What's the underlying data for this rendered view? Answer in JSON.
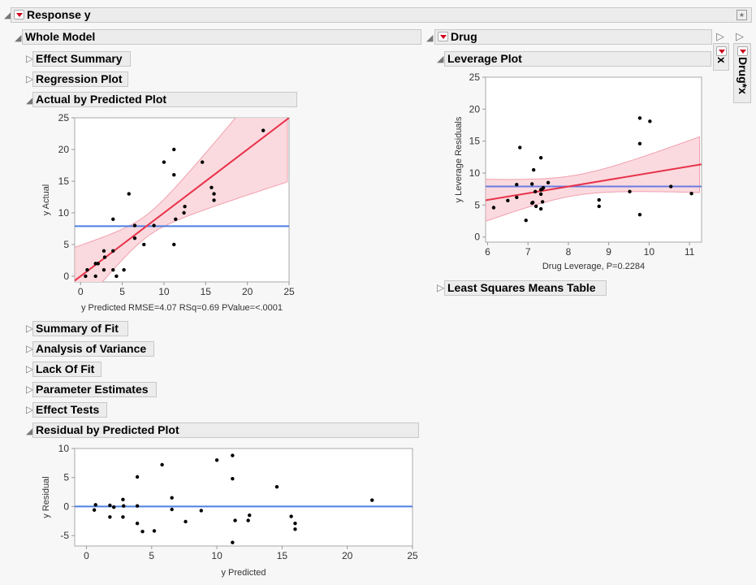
{
  "report": {
    "title": "Response y",
    "whole_model": "Whole Model",
    "sections_left": [
      {
        "label": "Effect Summary",
        "state": "collapsed"
      },
      {
        "label": "Regression Plot",
        "state": "collapsed"
      },
      {
        "label": "Actual by Predicted Plot",
        "state": "expanded"
      },
      {
        "label": "Summary of Fit",
        "state": "collapsed"
      },
      {
        "label": "Analysis of Variance",
        "state": "collapsed"
      },
      {
        "label": "Lack Of Fit",
        "state": "collapsed"
      },
      {
        "label": "Parameter Estimates",
        "state": "collapsed"
      },
      {
        "label": "Effect Tests",
        "state": "collapsed"
      },
      {
        "label": "Residual by Predicted Plot",
        "state": "expanded"
      }
    ],
    "drug": "Drug",
    "leverage_plot": "Leverage Plot",
    "ls_means": "Least Squares Means Table",
    "tab_x": "x",
    "tab_drugx": "Drug*x"
  },
  "colors": {
    "fit_line": "#e8334a",
    "ci_band": "#fadadf",
    "mean_line_blue": "#4d7fe0",
    "mean_line_lev": "#6b7be0"
  },
  "chart_data": [
    {
      "type": "scatter",
      "name": "actual-by-predicted",
      "xlabel": "y Predicted RMSE=4.07 RSq=0.69 PValue=<.0001",
      "ylabel": "y Actual",
      "xlim": [
        -0.7,
        25
      ],
      "ylim": [
        -0.9,
        25
      ],
      "xticks": [
        0,
        5,
        10,
        15,
        20,
        25
      ],
      "yticks": [
        0,
        5,
        10,
        15,
        20,
        25
      ],
      "mean_line": 7.9,
      "fit": {
        "slope": 1,
        "intercept": 0
      },
      "points": [
        [
          0.6,
          0
        ],
        [
          0.8,
          1
        ],
        [
          1.8,
          0
        ],
        [
          1.8,
          2
        ],
        [
          2.1,
          2
        ],
        [
          2.8,
          1
        ],
        [
          2.8,
          4
        ],
        [
          2.9,
          3
        ],
        [
          3.9,
          1
        ],
        [
          3.9,
          4
        ],
        [
          3.9,
          9
        ],
        [
          4.3,
          0
        ],
        [
          5.2,
          1
        ],
        [
          5.8,
          13
        ],
        [
          6.5,
          6
        ],
        [
          6.5,
          8
        ],
        [
          7.6,
          5
        ],
        [
          8.8,
          8
        ],
        [
          10.0,
          18
        ],
        [
          11.2,
          20
        ],
        [
          11.2,
          16
        ],
        [
          11.2,
          5
        ],
        [
          11.4,
          9
        ],
        [
          12.4,
          10
        ],
        [
          12.5,
          11
        ],
        [
          14.6,
          18
        ],
        [
          15.7,
          14
        ],
        [
          16,
          13
        ],
        [
          16,
          12
        ],
        [
          21.9,
          23
        ]
      ]
    },
    {
      "type": "scatter",
      "name": "leverage-plot",
      "xlabel": "Drug Leverage, P=0.2284",
      "ylabel": "y Leverage Residuals",
      "xlim": [
        5.95,
        11.3
      ],
      "ylim": [
        -0.8,
        25
      ],
      "xticks": [
        6,
        7,
        8,
        9,
        10,
        11
      ],
      "yticks": [
        0,
        5,
        10,
        15,
        20,
        25
      ],
      "mean_line": 7.9,
      "fit": {
        "slope": 1,
        "intercept": 0
      },
      "points": [
        [
          6.15,
          4.6
        ],
        [
          6.5,
          5.7
        ],
        [
          6.72,
          6.2
        ],
        [
          6.72,
          8.2
        ],
        [
          6.8,
          14
        ],
        [
          6.95,
          2.6
        ],
        [
          7.1,
          8.3
        ],
        [
          7.1,
          5.3
        ],
        [
          7.12,
          5.4
        ],
        [
          7.14,
          10.5
        ],
        [
          7.18,
          7.1
        ],
        [
          7.2,
          4.8
        ],
        [
          7.32,
          12.4
        ],
        [
          7.32,
          7.4
        ],
        [
          7.32,
          6.7
        ],
        [
          7.32,
          4.4
        ],
        [
          7.35,
          7.5
        ],
        [
          7.36,
          5.5
        ],
        [
          7.38,
          7.7
        ],
        [
          7.5,
          8.5
        ],
        [
          8.76,
          5.8
        ],
        [
          8.76,
          4.8
        ],
        [
          9.52,
          7.1
        ],
        [
          9.77,
          18.6
        ],
        [
          9.77,
          14.6
        ],
        [
          9.77,
          3.5
        ],
        [
          10.02,
          18.1
        ],
        [
          10.54,
          7.9
        ],
        [
          11.05,
          6.8
        ]
      ]
    },
    {
      "type": "scatter",
      "name": "residual-by-predicted",
      "xlabel": "y Predicted",
      "ylabel": "y Residual",
      "xlim": [
        -0.9,
        25
      ],
      "ylim": [
        -6.8,
        10
      ],
      "xticks": [
        0,
        5,
        10,
        15,
        20,
        25
      ],
      "yticks": [
        -5,
        0,
        5,
        10
      ],
      "mean_line": 0,
      "points": [
        [
          0.6,
          -0.6
        ],
        [
          0.7,
          0.3
        ],
        [
          1.8,
          0.2
        ],
        [
          1.8,
          -1.8
        ],
        [
          2.1,
          -0.1
        ],
        [
          2.8,
          1.2
        ],
        [
          2.8,
          -1.8
        ],
        [
          2.85,
          0.1
        ],
        [
          3.9,
          5.1
        ],
        [
          3.9,
          0.1
        ],
        [
          3.9,
          -2.9
        ],
        [
          4.3,
          -4.3
        ],
        [
          5.2,
          -4.2
        ],
        [
          5.8,
          7.2
        ],
        [
          6.55,
          1.5
        ],
        [
          6.55,
          -0.5
        ],
        [
          7.6,
          -2.6
        ],
        [
          8.8,
          -0.7
        ],
        [
          10.0,
          8.0
        ],
        [
          11.2,
          8.8
        ],
        [
          11.2,
          4.8
        ],
        [
          11.2,
          -6.2
        ],
        [
          11.4,
          -2.4
        ],
        [
          12.4,
          -2.4
        ],
        [
          12.5,
          -1.5
        ],
        [
          14.6,
          3.4
        ],
        [
          15.7,
          -1.7
        ],
        [
          16,
          -2.9
        ],
        [
          16,
          -3.9
        ],
        [
          21.9,
          1.1
        ]
      ]
    }
  ]
}
